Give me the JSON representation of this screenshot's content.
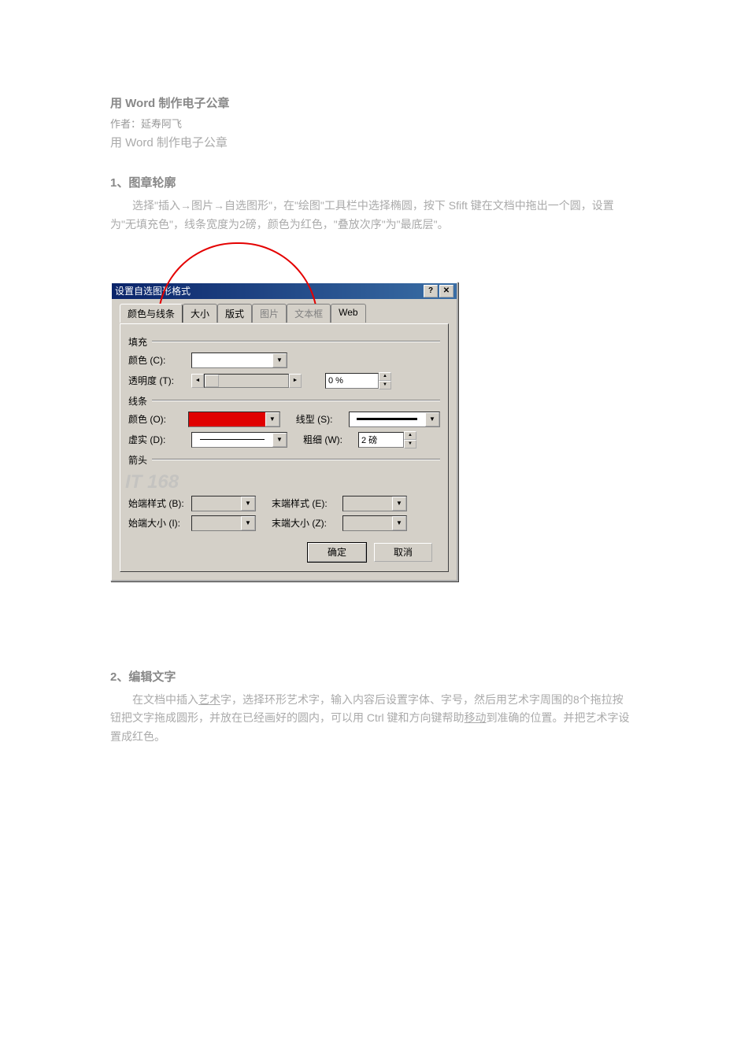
{
  "article": {
    "title": "用 Word 制作电子公章",
    "author_line": "作者：延寿阿飞",
    "subtitle": "用 Word 制作电子公章",
    "section1_head": "1、图章轮廓",
    "section1_body_a": "选择\"插入→图片→自选图形\"，在\"绘图\"工具栏中选择椭圆，按下 Sfift 键在文档中拖出一个圆，设置为\"无填充色\"，线条宽度为2磅，颜色为红色，\"叠放次序\"为\"最底层\"。",
    "section2_head": "2、编辑文字",
    "section2_body_a": "在文档中插入",
    "section2_link": "艺术",
    "section2_body_b": "字，选择环形艺术字，输入内容后设置字体、字号，然后用艺术字周围的8个拖拉按钮把文字拖成圆形，并放在已经画好的圆内，可以用 Ctrl 键和方向键帮助",
    "section2_link2": "移动",
    "section2_body_c": "到准确的位置。并把艺术字设置成红色。"
  },
  "dialog": {
    "title": "设置自选图形格式",
    "help_icon": "?",
    "close_icon": "✕",
    "tabs": {
      "colors": "颜色与线条",
      "size": "大小",
      "layout": "版式",
      "picture": "图片",
      "textbox": "文本框",
      "web": "Web"
    },
    "group_fill": "填充",
    "group_line": "线条",
    "group_arrow": "箭头",
    "labels": {
      "color_c": "颜色 (C):",
      "transparency": "透明度 (T):",
      "color_o": "颜色 (O):",
      "dashed": "虚实 (D):",
      "style": "线型 (S):",
      "weight": "粗细 (W):",
      "begin_style": "始端样式 (B):",
      "begin_size": "始端大小 (I):",
      "end_style": "末端样式 (E):",
      "end_size": "末端大小 (Z):"
    },
    "values": {
      "transparency": "0 %",
      "weight": "2 磅"
    },
    "watermark": "IT 168",
    "ok": "确定",
    "cancel": "取消"
  }
}
